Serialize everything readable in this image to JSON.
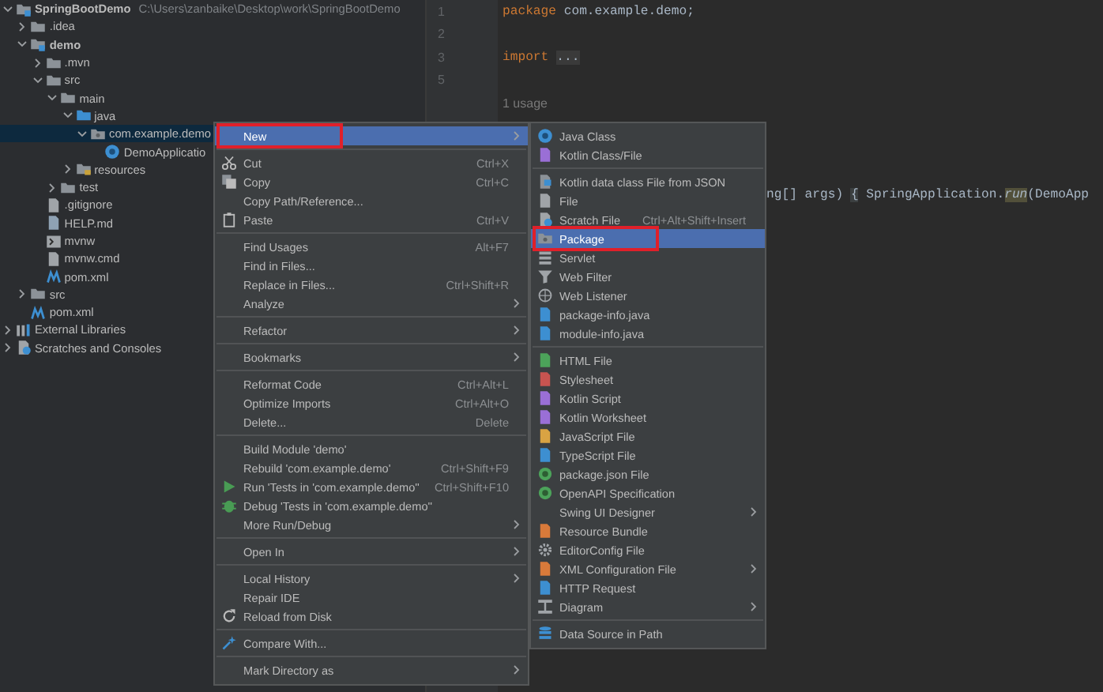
{
  "project_tree": {
    "items": [
      {
        "label": "SpringBootDemo",
        "kind": "module",
        "path": "C:\\Users\\zanbaike\\Desktop\\work\\SpringBootDemo",
        "expanded": true,
        "selected": false,
        "children": [
          {
            "label": ".idea",
            "kind": "folder",
            "expanded": false,
            "selected": false
          },
          {
            "label": "demo",
            "kind": "module",
            "expanded": true,
            "selected": false,
            "children": [
              {
                "label": ".mvn",
                "kind": "folder",
                "expanded": false,
                "selected": false
              },
              {
                "label": "src",
                "kind": "folder",
                "expanded": true,
                "selected": false,
                "children": [
                  {
                    "label": "main",
                    "kind": "folder",
                    "expanded": true,
                    "selected": false,
                    "children": [
                      {
                        "label": "java",
                        "kind": "source",
                        "expanded": true,
                        "selected": false,
                        "children": [
                          {
                            "label": "com.example.demo",
                            "kind": "package",
                            "expanded": true,
                            "selected": true,
                            "children": [
                              {
                                "label": "DemoApplicatio",
                                "kind": "class",
                                "selected": false
                              }
                            ]
                          }
                        ]
                      },
                      {
                        "label": "resources",
                        "kind": "resources",
                        "expanded": false,
                        "selected": false
                      }
                    ]
                  },
                  {
                    "label": "test",
                    "kind": "folder",
                    "expanded": false,
                    "selected": false
                  }
                ]
              },
              {
                "label": ".gitignore",
                "kind": "file",
                "selected": false
              },
              {
                "label": "HELP.md",
                "kind": "markdown",
                "selected": false
              },
              {
                "label": "mvnw",
                "kind": "script",
                "selected": false
              },
              {
                "label": "mvnw.cmd",
                "kind": "file",
                "selected": false
              },
              {
                "label": "pom.xml",
                "kind": "maven",
                "selected": false
              }
            ]
          },
          {
            "label": "src",
            "kind": "folder",
            "expanded": false,
            "selected": false
          },
          {
            "label": "pom.xml",
            "kind": "maven",
            "selected": false
          }
        ]
      },
      {
        "label": "External Libraries",
        "kind": "libraries",
        "expanded": false,
        "selected": false
      },
      {
        "label": "Scratches and Consoles",
        "kind": "scratches",
        "expanded": false,
        "selected": false
      }
    ]
  },
  "editor": {
    "lines": [
      {
        "kind": "code",
        "number": "1",
        "segments": [
          {
            "text": "package",
            "kind": "keyword"
          },
          {
            "text": " com.example.demo;",
            "kind": "plain"
          }
        ]
      },
      {
        "kind": "code",
        "number": "2"
      },
      {
        "kind": "code",
        "number": "3",
        "segments": [
          {
            "text": "import",
            "kind": "keyword"
          },
          {
            "text": "...",
            "kind": "fold"
          }
        ]
      },
      {
        "kind": "code",
        "number": "5"
      },
      {
        "kind": "hint",
        "text": "1 usage"
      },
      {
        "kind": "partial",
        "segments": [
          {
            "text": "ng[] args) ",
            "kind": "plain"
          },
          {
            "text": "{",
            "kind": "brace"
          },
          {
            "text": " SpringApplication.",
            "kind": "plain"
          },
          {
            "text": "run",
            "kind": "method"
          },
          {
            "text": "(DemoApp",
            "kind": "plain"
          }
        ]
      }
    ]
  },
  "context_menu": {
    "sections": [
      [
        {
          "label": "New",
          "submenu": true,
          "selected": true,
          "marked": true
        }
      ],
      [
        {
          "label": "Cut",
          "shortcut": "Ctrl+X",
          "submenu": false,
          "selected": false,
          "marked": false
        },
        {
          "label": "Copy",
          "shortcut": "Ctrl+C",
          "submenu": false,
          "selected": false,
          "marked": false
        },
        {
          "label": "Copy Path/Reference...",
          "submenu": false,
          "selected": false,
          "marked": false
        },
        {
          "label": "Paste",
          "shortcut": "Ctrl+V",
          "submenu": false,
          "selected": false,
          "marked": false
        }
      ],
      [
        {
          "label": "Find Usages",
          "shortcut": "Alt+F7",
          "submenu": false,
          "selected": false,
          "marked": false
        },
        {
          "label": "Find in Files...",
          "submenu": false,
          "selected": false,
          "marked": false
        },
        {
          "label": "Replace in Files...",
          "shortcut": "Ctrl+Shift+R",
          "submenu": false,
          "selected": false,
          "marked": false
        },
        {
          "label": "Analyze",
          "submenu": true,
          "selected": false,
          "marked": false
        }
      ],
      [
        {
          "label": "Refactor",
          "submenu": true,
          "selected": false,
          "marked": false
        }
      ],
      [
        {
          "label": "Bookmarks",
          "submenu": true,
          "selected": false,
          "marked": false
        }
      ],
      [
        {
          "label": "Reformat Code",
          "shortcut": "Ctrl+Alt+L",
          "submenu": false,
          "selected": false,
          "marked": false
        },
        {
          "label": "Optimize Imports",
          "shortcut": "Ctrl+Alt+O",
          "submenu": false,
          "selected": false,
          "marked": false
        },
        {
          "label": "Delete...",
          "shortcut": "Delete",
          "submenu": false,
          "selected": false,
          "marked": false
        }
      ],
      [
        {
          "label": "Build Module 'demo'",
          "submenu": false,
          "selected": false,
          "marked": false
        },
        {
          "label": "Rebuild 'com.example.demo'",
          "shortcut": "Ctrl+Shift+F9",
          "submenu": false,
          "selected": false,
          "marked": false
        },
        {
          "label": "Run 'Tests in 'com.example.demo''",
          "shortcut": "Ctrl+Shift+F10",
          "submenu": false,
          "selected": false,
          "marked": false
        },
        {
          "label": "Debug 'Tests in 'com.example.demo''",
          "submenu": false,
          "selected": false,
          "marked": false
        },
        {
          "label": "More Run/Debug",
          "submenu": true,
          "selected": false,
          "marked": false
        }
      ],
      [
        {
          "label": "Open In",
          "submenu": true,
          "selected": false,
          "marked": false
        }
      ],
      [
        {
          "label": "Local History",
          "submenu": true,
          "selected": false,
          "marked": false
        },
        {
          "label": "Repair IDE",
          "submenu": false,
          "selected": false,
          "marked": false
        },
        {
          "label": "Reload from Disk",
          "submenu": false,
          "selected": false,
          "marked": false
        }
      ],
      [
        {
          "label": "Compare With...",
          "submenu": false,
          "selected": false,
          "marked": false
        }
      ],
      [
        {
          "label": "Mark Directory as",
          "submenu": true,
          "selected": false,
          "marked": false
        }
      ]
    ]
  },
  "new_submenu": {
    "sections": [
      [
        {
          "label": "Java Class",
          "submenu": false,
          "selected": false,
          "marked": false
        },
        {
          "label": "Kotlin Class/File",
          "submenu": false,
          "selected": false,
          "marked": false
        }
      ],
      [
        {
          "label": "Kotlin data class File from JSON",
          "submenu": false,
          "selected": false,
          "marked": false
        },
        {
          "label": "File",
          "submenu": false,
          "selected": false,
          "marked": false
        },
        {
          "label": "Scratch File",
          "shortcut": "Ctrl+Alt+Shift+Insert",
          "submenu": false,
          "selected": false,
          "marked": false
        },
        {
          "label": "Package",
          "submenu": false,
          "selected": true,
          "marked": true
        },
        {
          "label": "Servlet",
          "submenu": false,
          "selected": false,
          "marked": false
        },
        {
          "label": "Web Filter",
          "submenu": false,
          "selected": false,
          "marked": false
        },
        {
          "label": "Web Listener",
          "submenu": false,
          "selected": false,
          "marked": false
        },
        {
          "label": "package-info.java",
          "submenu": false,
          "selected": false,
          "marked": false
        },
        {
          "label": "module-info.java",
          "submenu": false,
          "selected": false,
          "marked": false
        }
      ],
      [
        {
          "label": "HTML File",
          "submenu": false,
          "selected": false,
          "marked": false
        },
        {
          "label": "Stylesheet",
          "submenu": false,
          "selected": false,
          "marked": false
        },
        {
          "label": "Kotlin Script",
          "submenu": false,
          "selected": false,
          "marked": false
        },
        {
          "label": "Kotlin Worksheet",
          "submenu": false,
          "selected": false,
          "marked": false
        },
        {
          "label": "JavaScript File",
          "submenu": false,
          "selected": false,
          "marked": false
        },
        {
          "label": "TypeScript File",
          "submenu": false,
          "selected": false,
          "marked": false
        },
        {
          "label": "package.json File",
          "submenu": false,
          "selected": false,
          "marked": false
        },
        {
          "label": "OpenAPI Specification",
          "submenu": false,
          "selected": false,
          "marked": false
        },
        {
          "label": "Swing UI Designer",
          "submenu": true,
          "selected": false,
          "marked": false
        },
        {
          "label": "Resource Bundle",
          "submenu": false,
          "selected": false,
          "marked": false
        },
        {
          "label": "EditorConfig File",
          "submenu": false,
          "selected": false,
          "marked": false
        },
        {
          "label": "XML Configuration File",
          "submenu": true,
          "selected": false,
          "marked": false
        },
        {
          "label": "HTTP Request",
          "submenu": false,
          "selected": false,
          "marked": false
        },
        {
          "label": "Diagram",
          "submenu": true,
          "selected": false,
          "marked": false
        }
      ],
      [
        {
          "label": "Data Source in Path",
          "submenu": false,
          "selected": false,
          "marked": false
        }
      ]
    ]
  }
}
